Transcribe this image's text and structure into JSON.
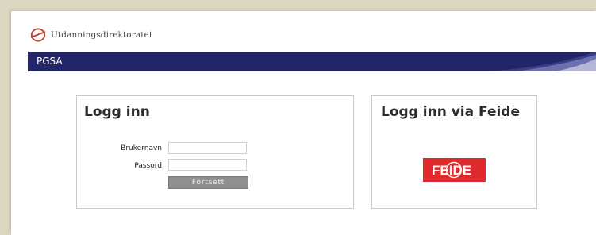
{
  "header": {
    "org_name": "Utdanningsdirektoratet",
    "logo_icon": "udir-logo-icon"
  },
  "banner": {
    "title": "PGSA",
    "color": "#232569"
  },
  "login": {
    "title": "Logg inn",
    "username_label": "Brukernavn",
    "username_value": "",
    "password_label": "Passord",
    "password_value": "",
    "submit_label": "Fortsett"
  },
  "feide": {
    "title": "Logg inn via Feide",
    "button_text": "FEIDE",
    "button_color": "#e0292c"
  }
}
